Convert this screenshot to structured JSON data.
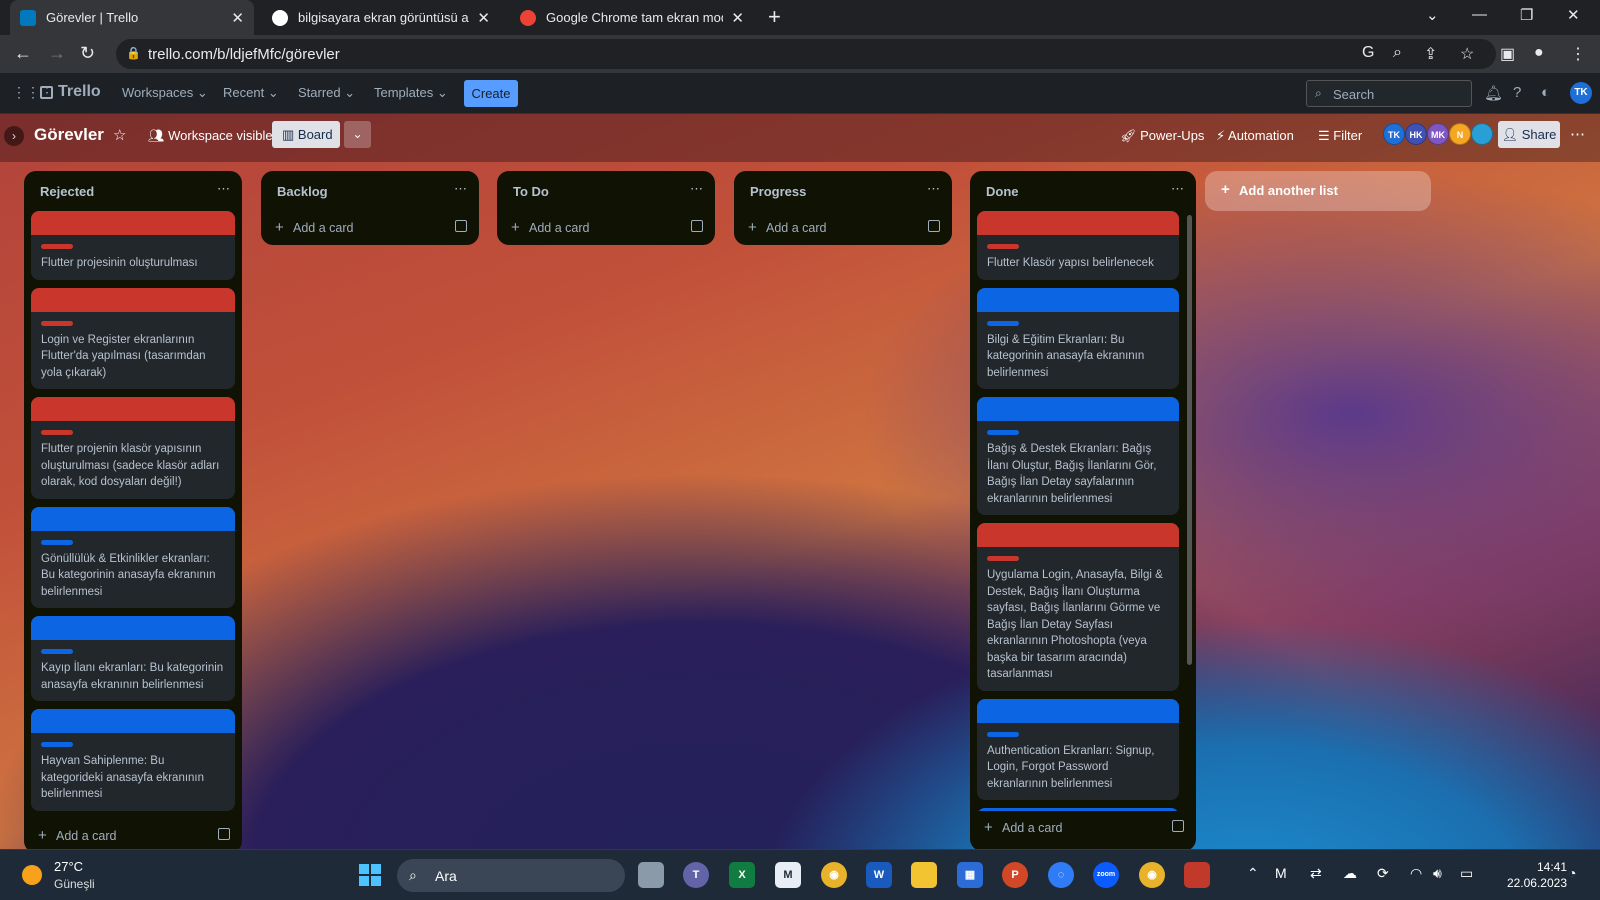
{
  "browser": {
    "tabs": [
      {
        "title": "Görevler | Trello",
        "favicon_color": "#0079bf",
        "active": true
      },
      {
        "title": "bilgisayara ekran görüntüsü alma",
        "favicon_color": "#ffffff",
        "active": false
      },
      {
        "title": "Google Chrome tam ekran modu",
        "favicon_color": "#ea4335",
        "active": false
      }
    ],
    "url": "trello.com/b/ldjefMfc/görevler"
  },
  "trello_header": {
    "logo": "Trello",
    "menus": [
      "Workspaces",
      "Recent",
      "Starred",
      "Templates"
    ],
    "create_label": "Create",
    "search_placeholder": "Search",
    "user_initials": "TK"
  },
  "board": {
    "title": "Görevler",
    "visibility": "Workspace visible",
    "view": "Board",
    "power_ups": "Power-Ups",
    "automation": "Automation",
    "filter": "Filter",
    "share": "Share",
    "members": [
      {
        "initials": "TK",
        "color": "#1f6fd8"
      },
      {
        "initials": "HK",
        "color": "#3f51b5"
      },
      {
        "initials": "MK",
        "color": "#7e57c2"
      },
      {
        "initials": "N",
        "color": "#f5a623"
      },
      {
        "initials": "",
        "color": "#2a9fd6"
      }
    ]
  },
  "lists": [
    {
      "title": "Rejected",
      "add_card": "Add a card",
      "cards": [
        {
          "color": "red",
          "text": "Flutter projesinin oluşturulması"
        },
        {
          "color": "red",
          "text": "Login ve Register ekranlarının Flutter'da yapılması (tasarımdan yola çıkarak)"
        },
        {
          "color": "red",
          "text": "Flutter projenin klasör yapısının oluşturulması (sadece klasör adları olarak, kod dosyaları değil!)"
        },
        {
          "color": "blue",
          "text": "Gönüllülük & Etkinlikler ekranları: Bu kategorinin anasayfa ekranının belirlenmesi"
        },
        {
          "color": "blue",
          "text": "Kayıp İlanı ekranları: Bu kategorinin anasayfa ekranının belirlenmesi"
        },
        {
          "color": "blue",
          "text": "Hayvan Sahiplenme: Bu kategorideki anasayfa ekranının belirlenmesi"
        }
      ]
    },
    {
      "title": "Backlog",
      "add_card": "Add a card",
      "cards": []
    },
    {
      "title": "To Do",
      "add_card": "Add a card",
      "cards": []
    },
    {
      "title": "Progress",
      "add_card": "Add a card",
      "cards": []
    },
    {
      "title": "Done",
      "add_card": "Add a card",
      "cards": [
        {
          "color": "red",
          "text": "Flutter Klasör yapısı belirlenecek"
        },
        {
          "color": "blue",
          "text": "Bilgi & Eğitim Ekranları: Bu kategorinin anasayfa ekranının belirlenmesi"
        },
        {
          "color": "blue",
          "text": "Bağış & Destek Ekranları: Bağış İlanı Oluştur, Bağış İlanlarını Gör, Bağış İlan Detay sayfalarının ekranlarının belirlenmesi"
        },
        {
          "color": "red",
          "text": "Uygulama Login, Anasayfa, Bilgi & Destek, Bağış İlanı Oluşturma sayfası, Bağış İlanlarını Görme ve Bağış İlan Detay Sayfası ekranlarının Photoshopta (veya başka bir tasarım aracında) tasarlanması"
        },
        {
          "color": "blue",
          "text": "Authentication Ekranları: Signup, Login, Forgot Password ekranlarının belirlenmesi"
        },
        {
          "color": "blue",
          "text": ""
        }
      ]
    }
  ],
  "add_list": "Add another list",
  "taskbar": {
    "temperature": "27°C",
    "condition": "Güneşli",
    "search_placeholder": "Ara",
    "time": "14:41",
    "date": "22.06.2023"
  }
}
